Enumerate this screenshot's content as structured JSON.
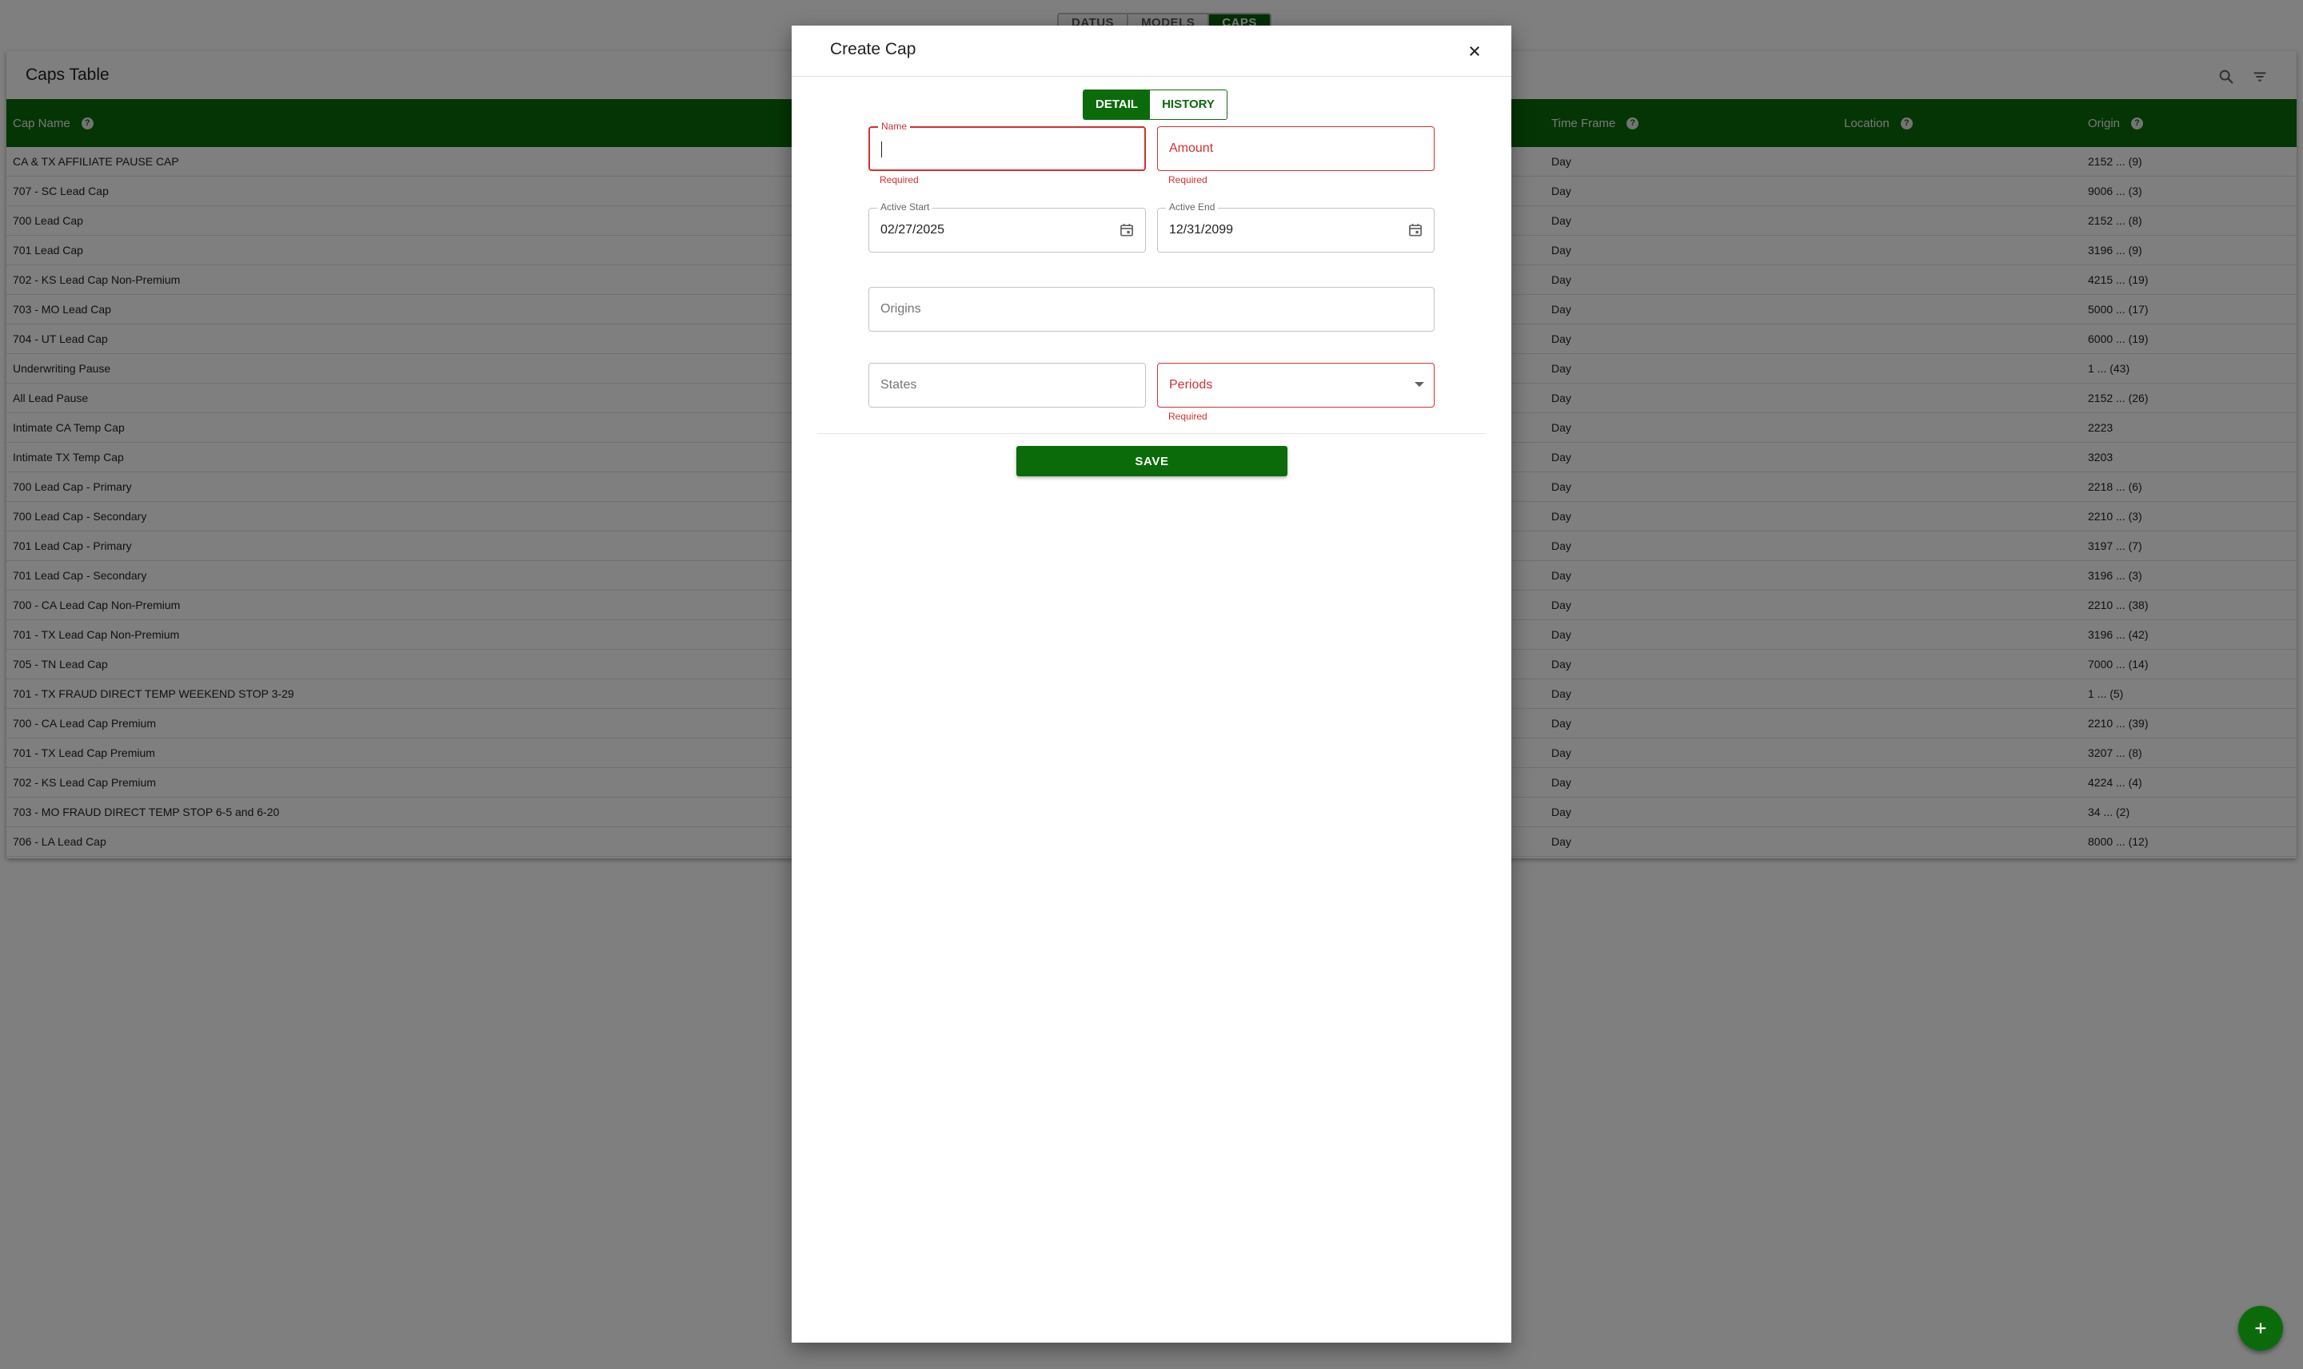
{
  "top_tabs": [
    "DATUS",
    "MODELS",
    "CAPS"
  ],
  "table": {
    "title": "Caps Table",
    "columns": {
      "cap_name": "Cap Name",
      "time_frame": "Time Frame",
      "location": "Location",
      "origin": "Origin"
    },
    "rows": [
      {
        "name": "CA & TX AFFILIATE PAUSE CAP",
        "time_frame": "Day",
        "origin": "2152 ... (9)"
      },
      {
        "name": "707 - SC Lead Cap",
        "time_frame": "Day",
        "origin": "9006 ... (3)"
      },
      {
        "name": "700 Lead Cap",
        "time_frame": "Day",
        "origin": "2152 ... (8)"
      },
      {
        "name": "701 Lead Cap",
        "time_frame": "Day",
        "origin": "3196 ... (9)"
      },
      {
        "name": "702 - KS Lead Cap Non-Premium",
        "time_frame": "Day",
        "origin": "4215 ... (19)"
      },
      {
        "name": "703 - MO Lead Cap",
        "time_frame": "Day",
        "origin": "5000 ... (17)"
      },
      {
        "name": "704 - UT Lead Cap",
        "time_frame": "Day",
        "origin": "6000 ... (19)"
      },
      {
        "name": "Underwriting Pause",
        "time_frame": "Day",
        "origin": "1 ... (43)"
      },
      {
        "name": "All Lead Pause",
        "time_frame": "Day",
        "origin": "2152 ... (26)"
      },
      {
        "name": "Intimate CA Temp Cap",
        "time_frame": "Day",
        "origin": "2223"
      },
      {
        "name": "Intimate TX Temp Cap",
        "time_frame": "Day",
        "origin": "3203"
      },
      {
        "name": "700 Lead Cap - Primary",
        "time_frame": "Day",
        "origin": "2218 ... (6)"
      },
      {
        "name": "700 Lead Cap - Secondary",
        "time_frame": "Day",
        "origin": "2210 ... (3)"
      },
      {
        "name": "701 Lead Cap - Primary",
        "time_frame": "Day",
        "origin": "3197 ... (7)"
      },
      {
        "name": "701 Lead Cap - Secondary",
        "time_frame": "Day",
        "origin": "3196 ... (3)"
      },
      {
        "name": "700 - CA Lead Cap Non-Premium",
        "time_frame": "Day",
        "origin": "2210 ... (38)"
      },
      {
        "name": "701 - TX Lead Cap Non-Premium",
        "time_frame": "Day",
        "origin": "3196 ... (42)"
      },
      {
        "name": "705 - TN Lead Cap",
        "time_frame": "Day",
        "origin": "7000 ... (14)"
      },
      {
        "name": "701 - TX FRAUD DIRECT TEMP WEEKEND STOP 3-29",
        "time_frame": "Day",
        "origin": "1 ... (5)"
      },
      {
        "name": "700 - CA Lead Cap Premium",
        "time_frame": "Day",
        "origin": "2210 ... (39)"
      },
      {
        "name": "701 - TX Lead Cap Premium",
        "time_frame": "Day",
        "origin": "3207 ... (8)"
      },
      {
        "name": "702 - KS Lead Cap Premium",
        "time_frame": "Day",
        "origin": "4224 ... (4)"
      },
      {
        "name": "703 - MO FRAUD DIRECT TEMP STOP 6-5 and 6-20",
        "time_frame": "Day",
        "origin": "34 ... (2)"
      },
      {
        "name": "706 - LA Lead Cap",
        "time_frame": "Day",
        "origin": "8000 ... (12)"
      }
    ]
  },
  "dialog": {
    "title": "Create Cap",
    "tabs": {
      "detail": "DETAIL",
      "history": "HISTORY"
    },
    "fields": {
      "name": {
        "label": "Name",
        "value": "",
        "helper": "Required"
      },
      "amount": {
        "placeholder": "Amount",
        "helper": "Required"
      },
      "active_start": {
        "label": "Active Start",
        "value": "02/27/2025"
      },
      "active_end": {
        "label": "Active End",
        "value": "12/31/2099"
      },
      "origins": {
        "placeholder": "Origins"
      },
      "states": {
        "placeholder": "States"
      },
      "periods": {
        "placeholder": "Periods",
        "helper": "Required"
      }
    },
    "save_label": "SAVE"
  },
  "icons": {
    "search": "search-icon",
    "filter": "filter-icon",
    "close": "close-icon",
    "calendar": "calendar-icon",
    "add": "add-icon",
    "help": "help-icon"
  },
  "colors": {
    "primary": "#0b6b0b",
    "error": "#d32f2f"
  }
}
